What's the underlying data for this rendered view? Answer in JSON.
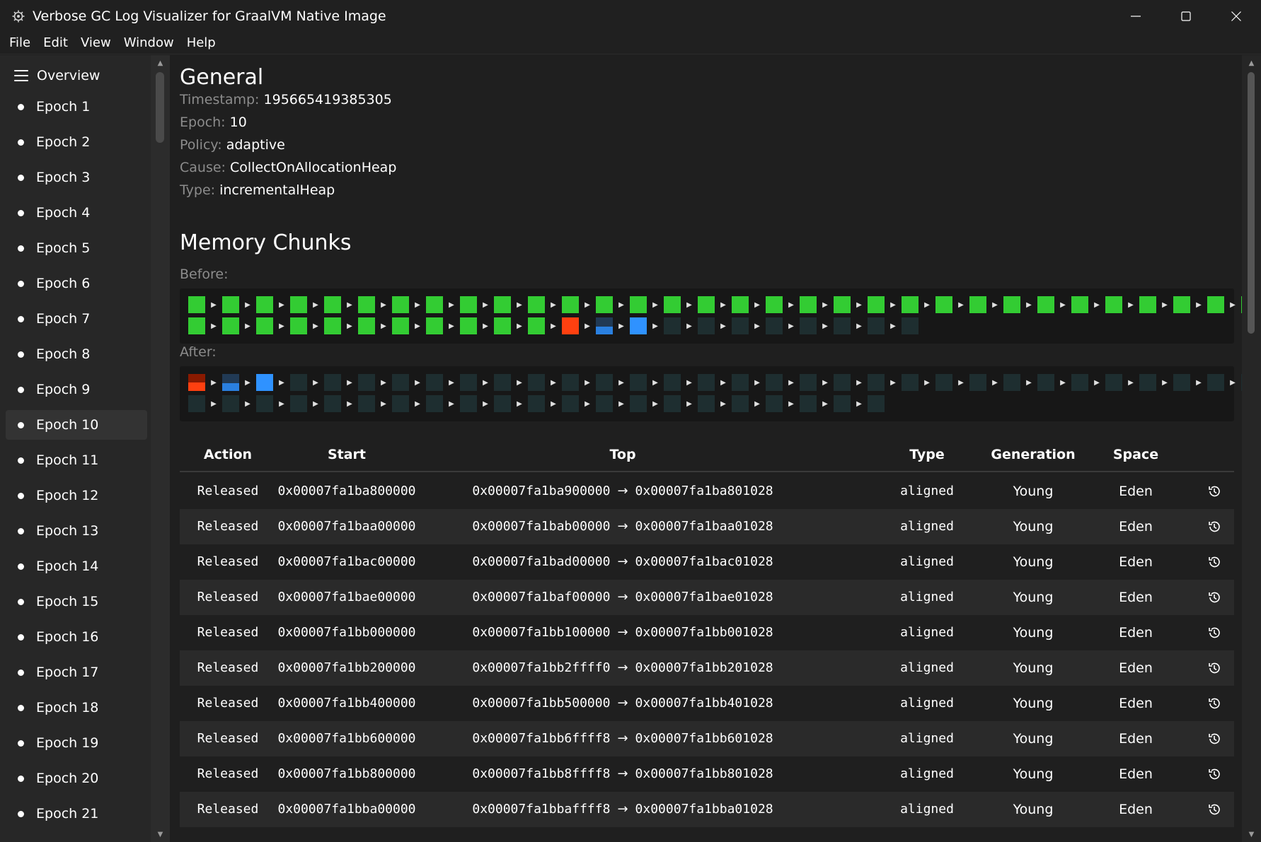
{
  "window": {
    "title": "Verbose GC Log Visualizer for GraalVM Native Image"
  },
  "menu": [
    "File",
    "Edit",
    "View",
    "Window",
    "Help"
  ],
  "sidebar": {
    "overview_label": "Overview",
    "items": [
      "Epoch 1",
      "Epoch 2",
      "Epoch 3",
      "Epoch 4",
      "Epoch 5",
      "Epoch 6",
      "Epoch 7",
      "Epoch 8",
      "Epoch 9",
      "Epoch 10",
      "Epoch 11",
      "Epoch 12",
      "Epoch 13",
      "Epoch 14",
      "Epoch 15",
      "Epoch 16",
      "Epoch 17",
      "Epoch 18",
      "Epoch 19",
      "Epoch 20",
      "Epoch 21"
    ],
    "selected": "Epoch 10"
  },
  "general": {
    "heading": "General",
    "fields": [
      {
        "key": "Timestamp:",
        "value": "195665419385305"
      },
      {
        "key": "Epoch:",
        "value": "10"
      },
      {
        "key": "Policy:",
        "value": "adaptive"
      },
      {
        "key": "Cause:",
        "value": "CollectOnAllocationHeap"
      },
      {
        "key": "Type:",
        "value": "incrementalHeap"
      }
    ]
  },
  "memory_chunks": {
    "heading": "Memory Chunks",
    "before_label": "Before:",
    "after_label": "After:",
    "before": {
      "row1": [
        "green",
        "green",
        "green",
        "green",
        "green",
        "green",
        "green",
        "green",
        "green",
        "green",
        "green",
        "green",
        "green",
        "green",
        "green",
        "green",
        "green",
        "green",
        "green",
        "green",
        "green",
        "green",
        "green",
        "green",
        "green",
        "green",
        "green",
        "green",
        "green",
        "green",
        "green",
        "green"
      ],
      "row2": [
        "green",
        "green",
        "green",
        "green",
        "green",
        "green",
        "green",
        "green",
        "green",
        "green",
        "green",
        "red",
        "halfblue",
        "blue",
        "empty",
        "empty",
        "empty",
        "empty",
        "empty",
        "empty",
        "empty",
        "empty"
      ]
    },
    "after": {
      "row1": [
        "darkred",
        "halfblue",
        "blue",
        "empty",
        "empty",
        "empty",
        "empty",
        "empty",
        "empty",
        "empty",
        "empty",
        "empty",
        "empty",
        "empty",
        "empty",
        "empty",
        "empty",
        "empty",
        "empty",
        "empty",
        "empty",
        "empty",
        "empty",
        "empty",
        "empty",
        "empty",
        "empty",
        "empty",
        "empty",
        "empty",
        "empty",
        "empty"
      ],
      "row2": [
        "empty",
        "empty",
        "empty",
        "empty",
        "empty",
        "empty",
        "empty",
        "empty",
        "empty",
        "empty",
        "empty",
        "empty",
        "empty",
        "empty",
        "empty",
        "empty",
        "empty",
        "empty",
        "empty",
        "empty",
        "empty"
      ]
    }
  },
  "colors": {
    "young_eden": "#33cc33",
    "old": "#ff4010",
    "survivor": "#2f92ff",
    "empty": "#1e2e30"
  },
  "table": {
    "headers": [
      "Action",
      "Start",
      "Top",
      "Type",
      "Generation",
      "Space"
    ],
    "rows": [
      {
        "action": "Released",
        "start": "0x00007fa1ba800000",
        "top_from": "0x00007fa1ba900000",
        "top_to": "0x00007fa1ba801028",
        "type": "aligned",
        "generation": "Young",
        "space": "Eden"
      },
      {
        "action": "Released",
        "start": "0x00007fa1baa00000",
        "top_from": "0x00007fa1bab00000",
        "top_to": "0x00007fa1baa01028",
        "type": "aligned",
        "generation": "Young",
        "space": "Eden"
      },
      {
        "action": "Released",
        "start": "0x00007fa1bac00000",
        "top_from": "0x00007fa1bad00000",
        "top_to": "0x00007fa1bac01028",
        "type": "aligned",
        "generation": "Young",
        "space": "Eden"
      },
      {
        "action": "Released",
        "start": "0x00007fa1bae00000",
        "top_from": "0x00007fa1baf00000",
        "top_to": "0x00007fa1bae01028",
        "type": "aligned",
        "generation": "Young",
        "space": "Eden"
      },
      {
        "action": "Released",
        "start": "0x00007fa1bb000000",
        "top_from": "0x00007fa1bb100000",
        "top_to": "0x00007fa1bb001028",
        "type": "aligned",
        "generation": "Young",
        "space": "Eden"
      },
      {
        "action": "Released",
        "start": "0x00007fa1bb200000",
        "top_from": "0x00007fa1bb2ffff0",
        "top_to": "0x00007fa1bb201028",
        "type": "aligned",
        "generation": "Young",
        "space": "Eden"
      },
      {
        "action": "Released",
        "start": "0x00007fa1bb400000",
        "top_from": "0x00007fa1bb500000",
        "top_to": "0x00007fa1bb401028",
        "type": "aligned",
        "generation": "Young",
        "space": "Eden"
      },
      {
        "action": "Released",
        "start": "0x00007fa1bb600000",
        "top_from": "0x00007fa1bb6ffff8",
        "top_to": "0x00007fa1bb601028",
        "type": "aligned",
        "generation": "Young",
        "space": "Eden"
      },
      {
        "action": "Released",
        "start": "0x00007fa1bb800000",
        "top_from": "0x00007fa1bb8ffff8",
        "top_to": "0x00007fa1bb801028",
        "type": "aligned",
        "generation": "Young",
        "space": "Eden"
      },
      {
        "action": "Released",
        "start": "0x00007fa1bba00000",
        "top_from": "0x00007fa1bbaffff8",
        "top_to": "0x00007fa1bba01028",
        "type": "aligned",
        "generation": "Young",
        "space": "Eden"
      }
    ],
    "row_icon": "history-icon"
  }
}
